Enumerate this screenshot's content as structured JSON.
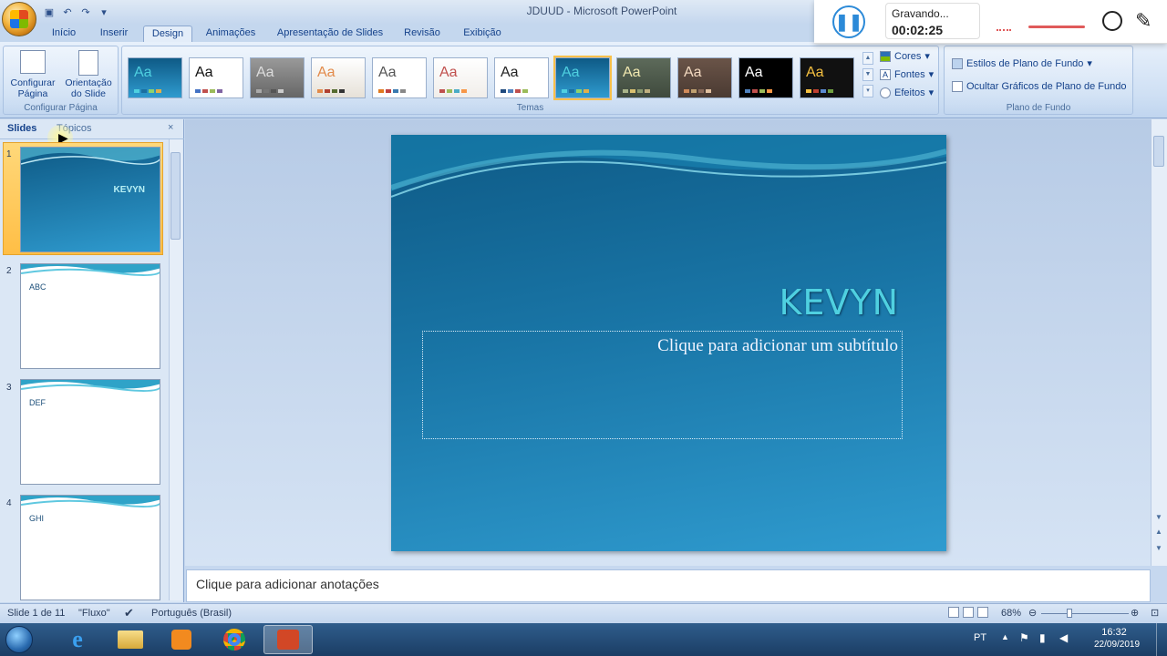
{
  "window": {
    "title": "JDUUD - Microsoft PowerPoint"
  },
  "tabs": [
    "Início",
    "Inserir",
    "Design",
    "Animações",
    "Apresentação de Slides",
    "Revisão",
    "Exibição"
  ],
  "active_tab": "Design",
  "ribbon": {
    "page_setup": {
      "btn1": "Configurar",
      "btn1b": "Página",
      "btn2": "Orientação",
      "btn2b": "do Slide",
      "label": "Configurar Página"
    },
    "themes": {
      "label": "Temas",
      "sample": "Aa"
    },
    "theme_cmds": {
      "colors": "Cores",
      "fonts": "Fontes",
      "effects": "Efeitos"
    },
    "background": {
      "styles": "Estilos de Plano de Fundo",
      "hide": "Ocultar Gráficos de Plano de Fundo",
      "label": "Plano de Fundo"
    }
  },
  "recorder": {
    "status": "Gravando...",
    "time": "00:02:25"
  },
  "left_pane": {
    "tab_slides": "Slides",
    "tab_topics": "Tópicos",
    "close": "×",
    "slides": [
      {
        "num": "1",
        "text": "KEVYN"
      },
      {
        "num": "2",
        "text": "ABC"
      },
      {
        "num": "3",
        "text": "DEF"
      },
      {
        "num": "4",
        "text": "GHI"
      }
    ]
  },
  "slide": {
    "title": "KEVYN",
    "subtitle": "Clique para adicionar um subtítulo"
  },
  "notes": {
    "placeholder": "Clique para adicionar anotações"
  },
  "status": {
    "slide": "Slide 1 de 11",
    "theme": "\"Fluxo\"",
    "language": "Português (Brasil)",
    "zoom": "68%"
  },
  "taskbar": {
    "lang": "PT",
    "time": "16:32",
    "date": "22/09/2019"
  },
  "colors": {
    "accent": "#4fd0e0",
    "ribbon": "#e3edf9",
    "slide_bg": "#1975a6"
  }
}
